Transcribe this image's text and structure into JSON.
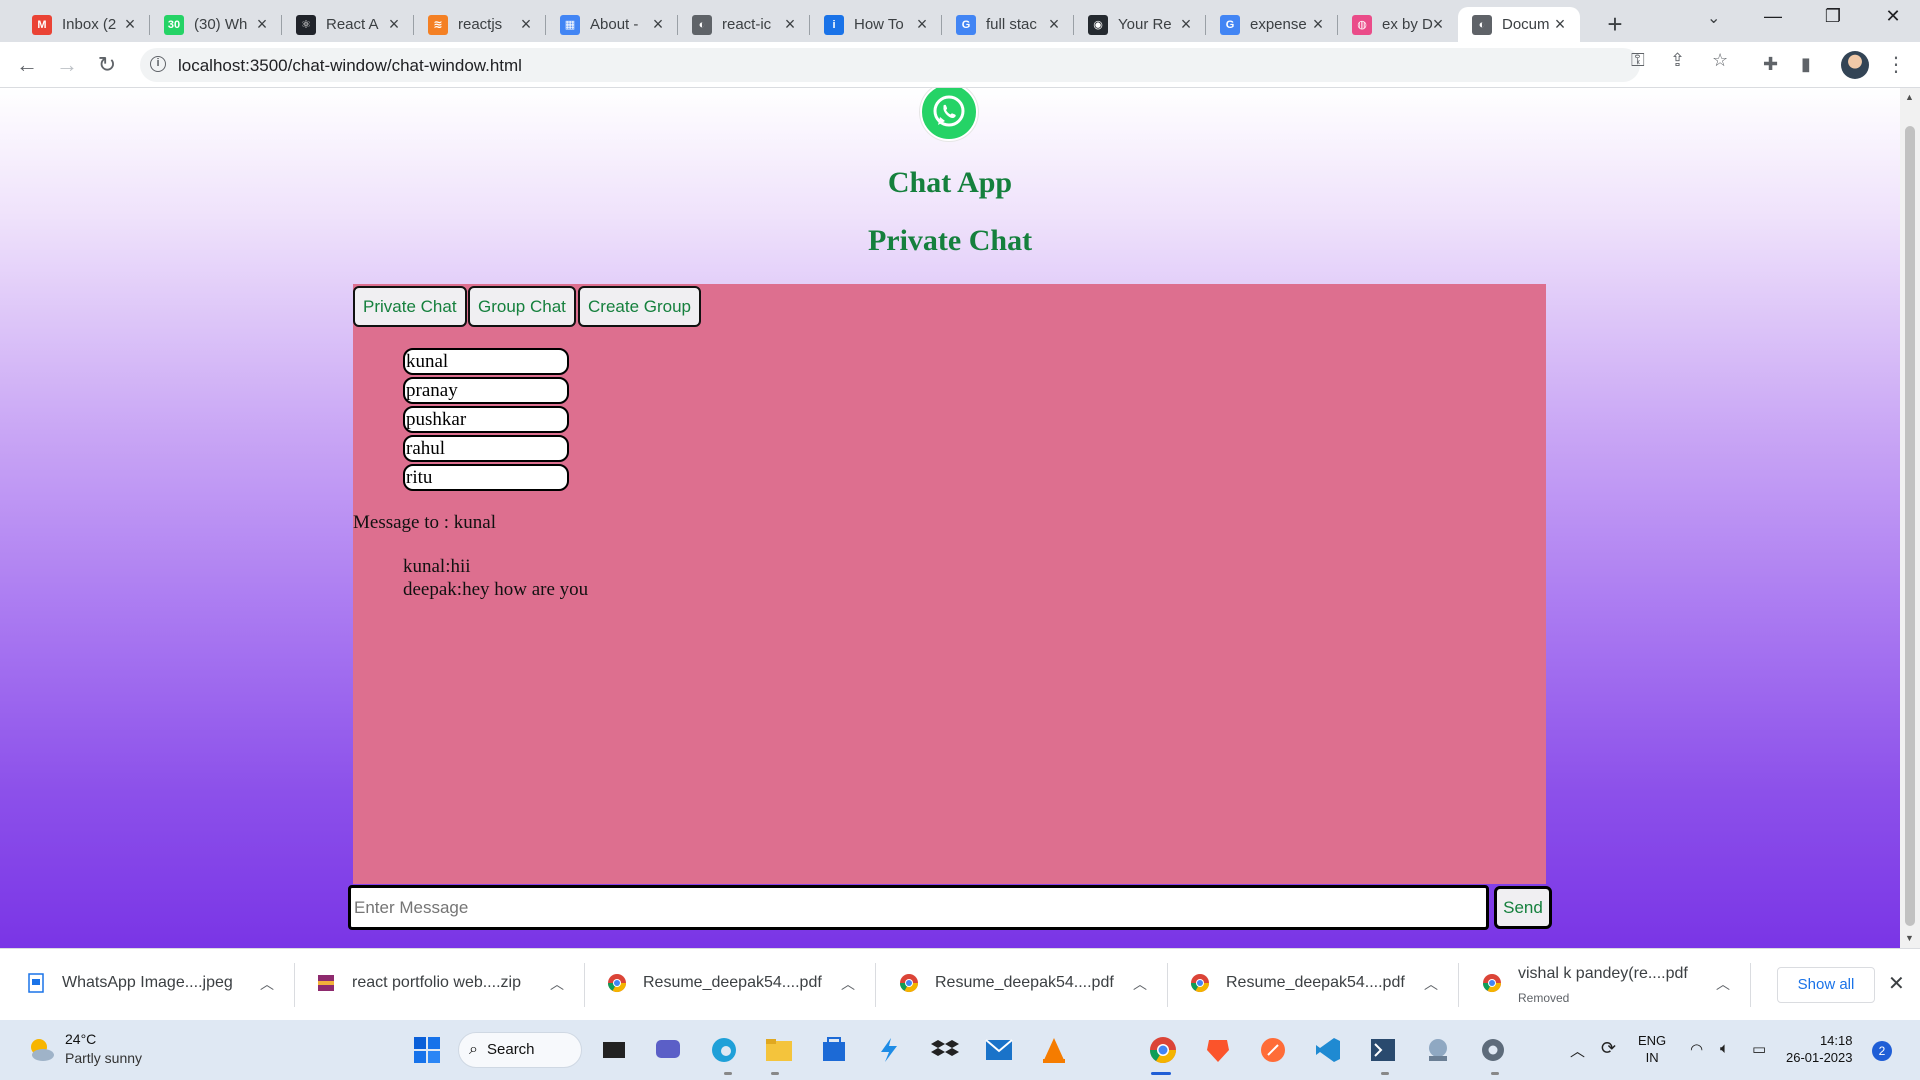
{
  "browser": {
    "tabs": [
      {
        "label": "Inbox (2",
        "icon": "gmail-icon",
        "color": "#ea4335",
        "glyph": "M"
      },
      {
        "label": "(30) Wh",
        "icon": "whatsapp-icon",
        "color": "#25d366",
        "glyph": "30"
      },
      {
        "label": "React A",
        "icon": "react-icon",
        "color": "#20232a",
        "glyph": "⚛"
      },
      {
        "label": "reactjs",
        "icon": "stackoverflow-icon",
        "color": "#f48024",
        "glyph": "≋"
      },
      {
        "label": "About -",
        "icon": "google-sites-icon",
        "color": "#4285f4",
        "glyph": "▦"
      },
      {
        "label": "react-ic",
        "icon": "globe-icon",
        "color": "#5f6368",
        "glyph": "◐"
      },
      {
        "label": "How To",
        "icon": "howto-icon",
        "color": "#1a73e8",
        "glyph": "i"
      },
      {
        "label": "full stac",
        "icon": "google-icon",
        "color": "#4285f4",
        "glyph": "G"
      },
      {
        "label": "Your Re",
        "icon": "github-icon",
        "color": "#24292f",
        "glyph": "◉"
      },
      {
        "label": "expense",
        "icon": "google-icon",
        "color": "#4285f4",
        "glyph": "G"
      },
      {
        "label": "ex by D",
        "icon": "dribbble-icon",
        "color": "#ea4c89",
        "glyph": "◍"
      },
      {
        "label": "Docum",
        "icon": "globe-icon",
        "color": "#5f6368",
        "glyph": "◐"
      }
    ],
    "url": "localhost:3500/chat-window/chat-window.html"
  },
  "page": {
    "app_title": "Chat App",
    "mode_title": "Private Chat",
    "buttons": {
      "private_chat": "Private Chat",
      "group_chat": "Group Chat",
      "create_group": "Create Group"
    },
    "contacts": [
      "kunal",
      "pranay",
      "pushkar",
      "rahul",
      "ritu"
    ],
    "message_to": "Message to : kunal",
    "messages": [
      "kunal:hii",
      "deepak:hey how are you"
    ],
    "input_placeholder": "Enter Message",
    "send_label": "Send",
    "colors": {
      "accent_green": "#15803d",
      "panel_pink": "#dd6f8f",
      "whatsapp_green": "#25d366"
    }
  },
  "downloads": {
    "items": [
      {
        "name": "WhatsApp Image....jpeg",
        "sub": "",
        "icon": "image-file-icon"
      },
      {
        "name": "react portfolio web....zip",
        "sub": "",
        "icon": "zip-file-icon"
      },
      {
        "name": "Resume_deepak54....pdf",
        "sub": "",
        "icon": "chrome-icon"
      },
      {
        "name": "Resume_deepak54....pdf",
        "sub": "",
        "icon": "chrome-icon"
      },
      {
        "name": "Resume_deepak54....pdf",
        "sub": "",
        "icon": "chrome-icon"
      },
      {
        "name": "vishal k pandey(re....pdf",
        "sub": "Removed",
        "icon": "chrome-icon"
      }
    ],
    "show_all": "Show all"
  },
  "taskbar": {
    "weather_temp": "24°C",
    "weather_desc": "Partly sunny",
    "search_label": "Search",
    "lang_line1": "ENG",
    "lang_line2": "IN",
    "time": "14:18",
    "date": "26-01-2023",
    "notifications": "2"
  }
}
